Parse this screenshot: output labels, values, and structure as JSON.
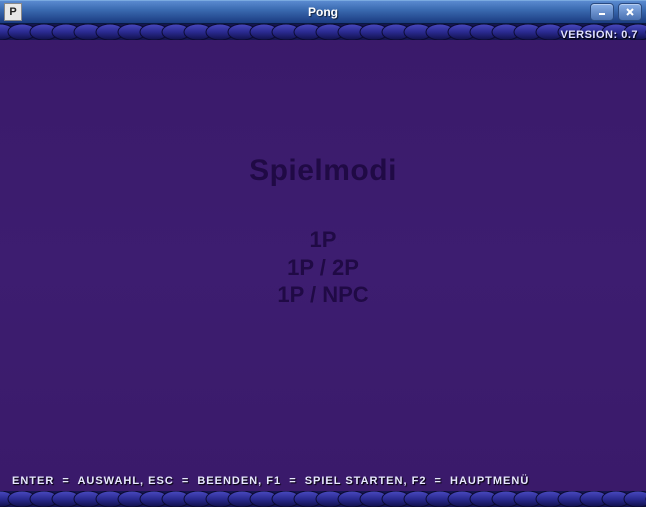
{
  "window": {
    "title": "Pong",
    "icon_letter": "P"
  },
  "game": {
    "version_label": "VERSION: 0.7",
    "menu_title": "Spielmodi",
    "options": [
      "1P",
      "1P / 2P",
      "1P / NPC"
    ],
    "hints": {
      "enter": "ENTER",
      "enter_action": "AUSWAHL",
      "esc": "ESC",
      "esc_action": "BEENDEN",
      "f1": "F1",
      "f1_action": "SPIEL STARTEN",
      "f2": "F2",
      "f2_action": "HAUPTMENÜ",
      "sep_kv": "=",
      "sep_pair": ","
    }
  }
}
